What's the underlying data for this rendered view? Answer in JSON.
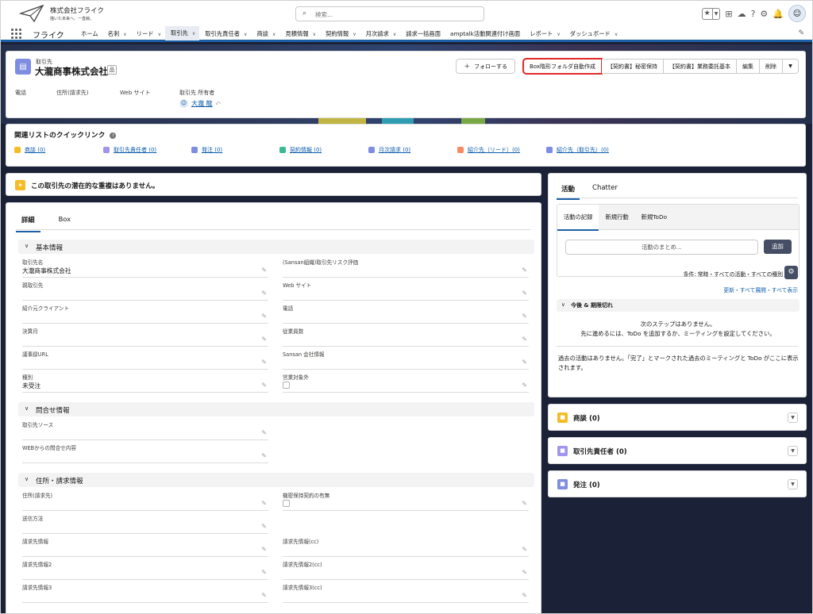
{
  "header": {
    "company_name": "株式会社フライク",
    "tagline": "描いた未来へ、一直線。",
    "search_placeholder": "検索..."
  },
  "nav": {
    "app_name": "フライク",
    "items": [
      {
        "label": "ホーム",
        "chevron": false
      },
      {
        "label": "名刺",
        "chevron": true
      },
      {
        "label": "リード",
        "chevron": true
      },
      {
        "label": "取引先",
        "chevron": true,
        "active": true
      },
      {
        "label": "取引先責任者",
        "chevron": true
      },
      {
        "label": "商談",
        "chevron": true
      },
      {
        "label": "見積情報",
        "chevron": true
      },
      {
        "label": "契約情報",
        "chevron": true
      },
      {
        "label": "月次請求",
        "chevron": true
      },
      {
        "label": "請求一括画面",
        "chevron": false
      },
      {
        "label": "amptalk活動関連付け画面",
        "chevron": false
      },
      {
        "label": "レポート",
        "chevron": true
      },
      {
        "label": "ダッシュボード",
        "chevron": true
      }
    ]
  },
  "record": {
    "object_type": "取引先",
    "name": "大瀧商事株式会社",
    "follow_label": "フォローする",
    "actions": [
      "Box階形フォルダ自動作成",
      "【契約書】秘密保持",
      "【契約書】業務委託基本",
      "編集",
      "削除"
    ],
    "highlighted_action": "Box階形フォルダ自動作成",
    "fields": {
      "phone_label": "電話",
      "address_label": "住所(請求先)",
      "website_label": "Web サイト",
      "owner_label": "取引先 所有者",
      "owner_value": "大瀧 龍"
    }
  },
  "quick_links": {
    "title": "関連リストのクイックリンク",
    "items": [
      {
        "label": "商談 (0)",
        "color": "#f4bc25"
      },
      {
        "label": "取引先責任者 (0)",
        "color": "#a094ed"
      },
      {
        "label": "発注 (0)",
        "color": "#7f8de1"
      },
      {
        "label": "契約情報 (0)",
        "color": "#3bba95"
      },
      {
        "label": "月次請求 (0)",
        "color": "#7f8de1"
      },
      {
        "label": "紹介先（リード）(0)",
        "color": "#f88962"
      },
      {
        "label": "紹介先（取引先）(0)",
        "color": "#7f8de1"
      }
    ]
  },
  "duplicate": {
    "message": "この取引先の潜在的な重複はありません。"
  },
  "detail": {
    "tabs": [
      "詳細",
      "Box"
    ],
    "sections": [
      {
        "title": "基本情報",
        "rows": [
          [
            {
              "label": "取引先名",
              "value": "大瀧商事株式会社"
            },
            {
              "label": "(Sansan組織)取引先リスク評価",
              "value": ""
            }
          ],
          [
            {
              "label": "親取引先",
              "value": ""
            },
            {
              "label": "Web サイト",
              "value": ""
            }
          ],
          [
            {
              "label": "紹介元クライアント",
              "value": ""
            },
            {
              "label": "電話",
              "value": ""
            }
          ],
          [
            {
              "label": "決算月",
              "value": ""
            },
            {
              "label": "従業員数",
              "value": ""
            }
          ],
          [
            {
              "label": "議事録URL",
              "value": ""
            },
            {
              "label": "Sansan 会社情報",
              "value": ""
            }
          ],
          [
            {
              "label": "種別",
              "value": "未受注"
            },
            {
              "label": "営業対象外",
              "value": "",
              "checkbox": true
            }
          ]
        ]
      },
      {
        "title": "問合せ情報",
        "rows": [
          [
            {
              "label": "取引先ソース",
              "value": ""
            },
            null
          ],
          [
            {
              "label": "WEBからの問合せ内容",
              "value": ""
            },
            null
          ]
        ]
      },
      {
        "title": "住所・請求情報",
        "rows": [
          [
            {
              "label": "住所(請求先)",
              "value": ""
            },
            {
              "label": "機密保持契約の有無",
              "value": "",
              "checkbox": true
            }
          ],
          [
            {
              "label": "送信方法",
              "value": ""
            },
            null
          ],
          [
            {
              "label": "請求先情報",
              "value": ""
            },
            {
              "label": "請求先情報(cc)",
              "value": ""
            }
          ],
          [
            {
              "label": "請求先情報2",
              "value": ""
            },
            {
              "label": "請求先情報2(cc)",
              "value": ""
            }
          ],
          [
            {
              "label": "請求先情報3",
              "value": ""
            },
            {
              "label": "請求先情報3(cc)",
              "value": ""
            }
          ]
        ]
      }
    ]
  },
  "activity": {
    "tabs": [
      "活動",
      "Chatter"
    ],
    "sub_tabs": [
      "活動の記録",
      "新規行動",
      "新規ToDo"
    ],
    "summary_placeholder": "活動のまとめ...",
    "add_label": "追加",
    "filter_text": "条件: 常時・すべての活動・すべての種別",
    "links_text": "更新・すべて展開・すべて表示",
    "upcoming_title": "今後 & 期限切れ",
    "no_steps_1": "次のステップはありません。",
    "no_steps_2": "先に進めるには、ToDo を追加するか、ミーティングを設定してください。",
    "no_past": "過去の活動はありません。「完了」とマークされた過去のミーティングと ToDo がここに表示されます。"
  },
  "related_lists": [
    {
      "label": "商談 (0)",
      "color": "#f4bc25",
      "icon": "opportunity-icon"
    },
    {
      "label": "取引先責任者 (0)",
      "color": "#a094ed",
      "icon": "contact-icon"
    },
    {
      "label": "発注 (0)",
      "color": "#7f8de1",
      "icon": "order-icon"
    }
  ]
}
